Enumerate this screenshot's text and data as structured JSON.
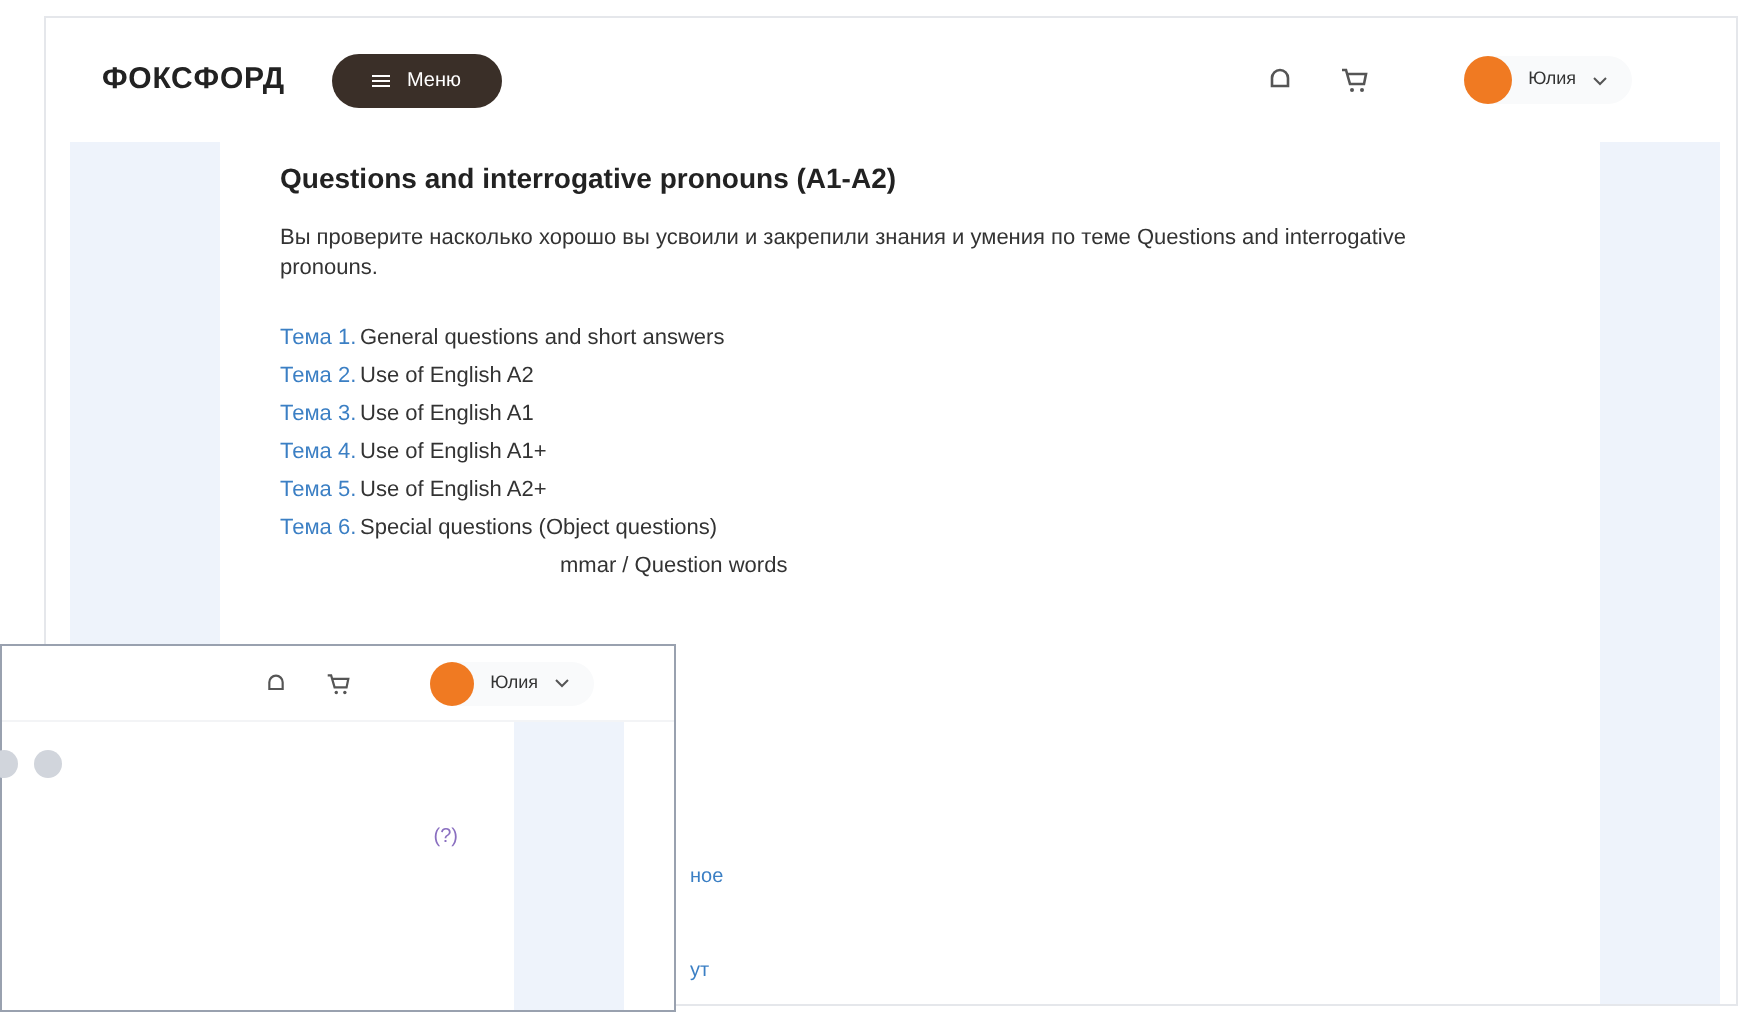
{
  "back_screen": {
    "logo": "ФОКСФОРД",
    "menu_button": "Меню",
    "user": {
      "name": "Юлия"
    },
    "title": "Questions and interrogative pronouns (A1-A2)",
    "description": "Вы проверите насколько хорошо вы усвоили и закрепили знания и умения по теме Questions and interrogative pronouns.",
    "topics": [
      {
        "label": "Тема 1.",
        "title": "General questions and short answers"
      },
      {
        "label": "Тема 2.",
        "title": "Use of English A2"
      },
      {
        "label": "Тема 3.",
        "title": "Use of English A1"
      },
      {
        "label": "Тема 4.",
        "title": "Use of English A1+"
      },
      {
        "label": "Тема 5.",
        "title": "Use of English A2+"
      },
      {
        "label": "Тема 6.",
        "title": "Special questions (Object questions)"
      },
      {
        "title": "mmar / Question words"
      }
    ],
    "fragments": [
      "ное",
      "ут"
    ]
  },
  "front_screen": {
    "user": {
      "name": "Юлия"
    },
    "help_mark": "(?)"
  }
}
